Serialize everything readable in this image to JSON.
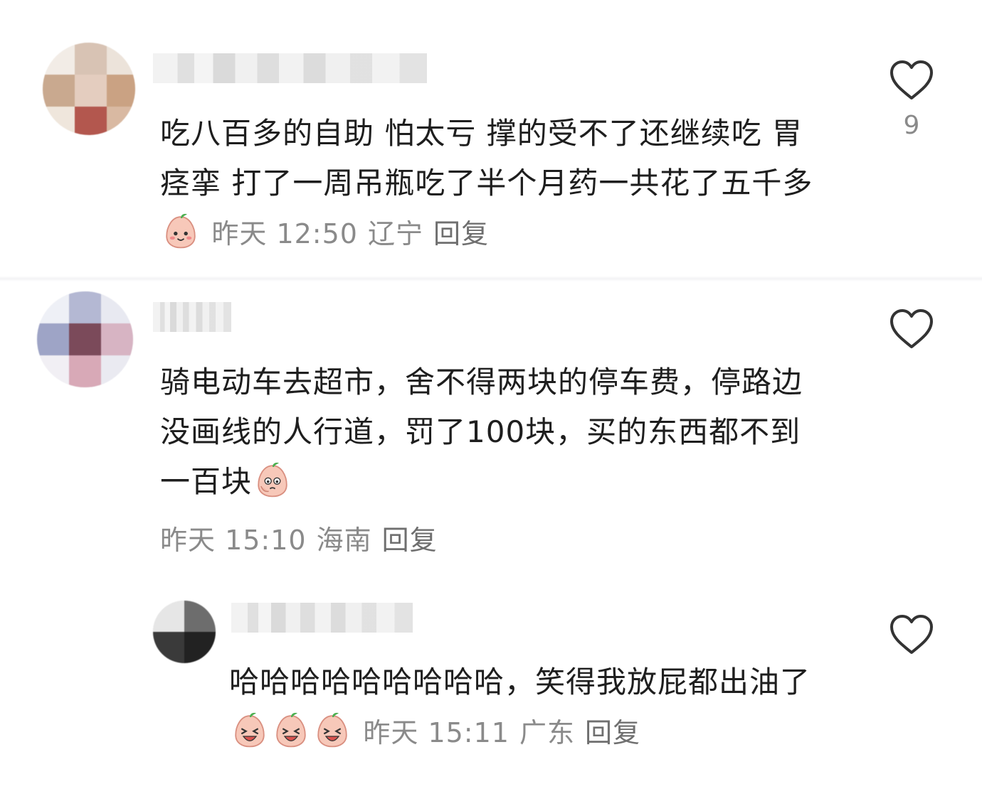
{
  "comments": [
    {
      "text": "吃八百多的自助 怕太亏 撑的受不了还继续吃 胃痉挛 打了一周吊瓶吃了半个月药一共花了五千多",
      "emoji": "smile-emoji",
      "time": "昨天 12:50",
      "location": "辽宁",
      "reply_label": "回复",
      "likes": "9"
    },
    {
      "text": "骑电动车去超市，舍不得两块的停车费，停路边没画线的人行道，罚了100块，买的东西都不到一百块",
      "emoji": "facepalm-emoji",
      "time": "昨天 15:10",
      "location": "海南",
      "reply_label": "回复",
      "likes": ""
    },
    {
      "text": "哈哈哈哈哈哈哈哈哈，笑得我放屁都出油了",
      "emoji": "laughing-emoji",
      "time": "昨天 15:11",
      "location": "广东",
      "reply_label": "回复",
      "likes": ""
    }
  ],
  "colors": {
    "text": "#1e1e1e",
    "meta": "#8a8a8a",
    "heart": "#333333",
    "emoji_face": "#f7c8b9",
    "emoji_leaf": "#4caf50"
  },
  "icons": {
    "like": "heart-outline-icon"
  }
}
